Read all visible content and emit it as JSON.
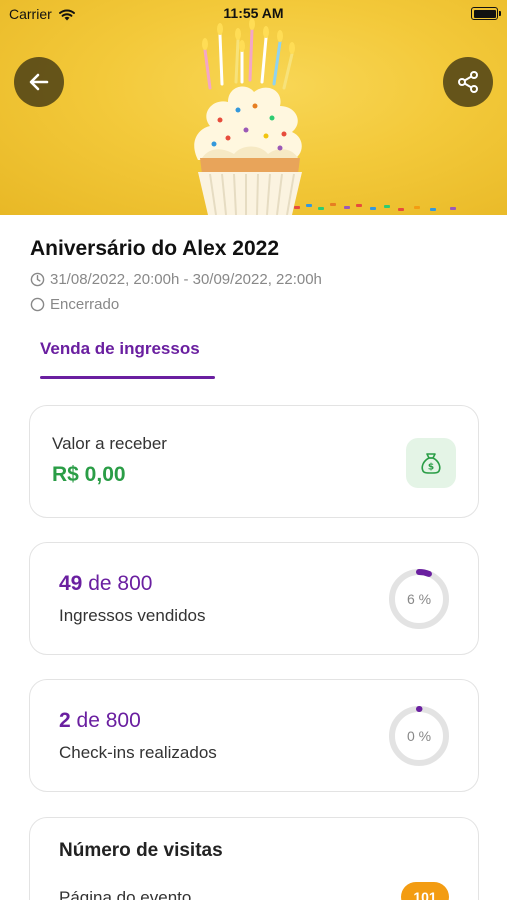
{
  "status_bar": {
    "carrier": "Carrier",
    "time": "11:55 AM"
  },
  "header": {
    "back_icon": "arrow-left-icon",
    "share_icon": "share-icon"
  },
  "event": {
    "title": "Aniversário do Alex 2022",
    "datetime": "31/08/2022, 20:00h - 30/09/2022, 22:00h",
    "status": "Encerrado"
  },
  "tabs": [
    {
      "label": "Venda de ingressos",
      "active": true
    }
  ],
  "cards": {
    "receive": {
      "label": "Valor a receber",
      "amount": "R$ 0,00",
      "icon": "money-bag-icon"
    },
    "sold": {
      "count": "49",
      "of_text": "de 800",
      "label": "Ingressos vendidos",
      "percent_text": "6 %",
      "percent": 6
    },
    "checkins": {
      "count": "2",
      "of_text": "de 800",
      "label": "Check-ins realizados",
      "percent_text": "0 %",
      "percent": 0
    },
    "visits": {
      "title": "Número de visitas",
      "row_label": "Página do evento",
      "row_value": "101"
    }
  },
  "colors": {
    "accent": "#6a1fa0",
    "money": "#2a9d46",
    "badge": "#f39c12",
    "hero": "#f3c93a"
  }
}
